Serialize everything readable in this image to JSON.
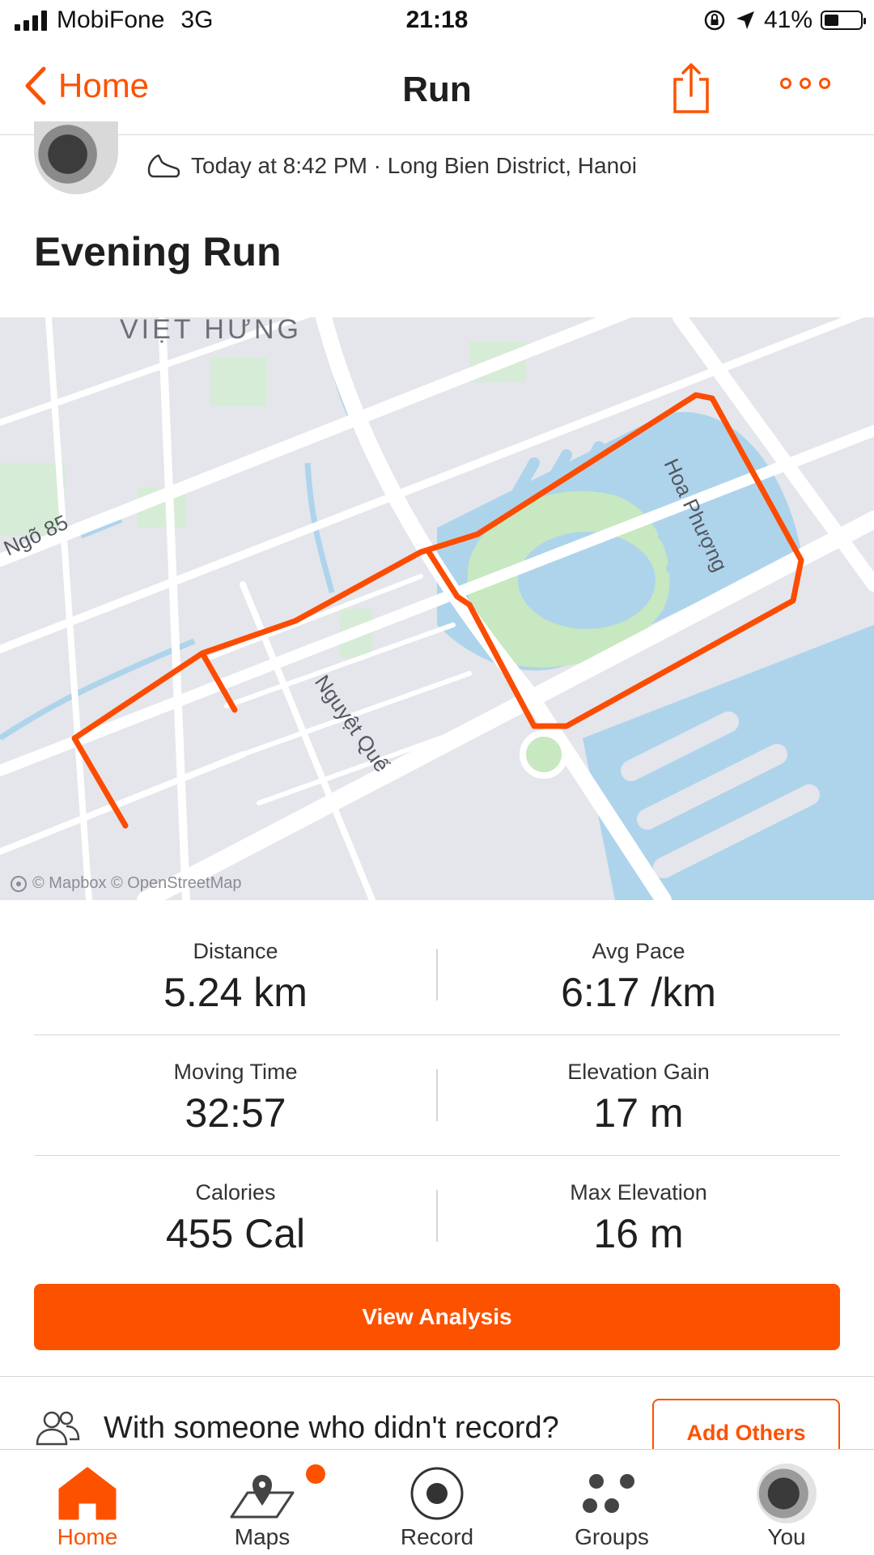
{
  "status_bar": {
    "carrier": "MobiFone",
    "network": "3G",
    "time": "21:18",
    "battery": "41%",
    "battery_level": 0.41
  },
  "nav": {
    "back_label": "Home",
    "title": "Run"
  },
  "activity": {
    "meta": "Today at 8:42 PM · Long Bien District, Hanoi",
    "title": "Evening Run"
  },
  "map": {
    "labels": {
      "district": "VIỆT HƯNG",
      "street_1": "Ngõ 85",
      "street_2": "Hoa Phượng",
      "street_3": "Nguyệt Quế"
    },
    "credit": "© Mapbox © OpenStreetMap",
    "route_color": "#fc4c02"
  },
  "stats": [
    {
      "label": "Distance",
      "value": "5.24 km"
    },
    {
      "label": "Avg Pace",
      "value": "6:17 /km"
    },
    {
      "label": "Moving Time",
      "value": "32:57"
    },
    {
      "label": "Elevation Gain",
      "value": "17 m"
    },
    {
      "label": "Calories",
      "value": "455 Cal"
    },
    {
      "label": "Max Elevation",
      "value": "16 m"
    }
  ],
  "actions": {
    "view_analysis": "View Analysis",
    "others_prompt": "With someone who didn't record?",
    "add_others": "Add Others"
  },
  "tabs": [
    {
      "label": "Home",
      "icon": "home-icon",
      "active": true
    },
    {
      "label": "Maps",
      "icon": "maps-icon",
      "active": false
    },
    {
      "label": "Record",
      "icon": "record-icon",
      "active": false
    },
    {
      "label": "Groups",
      "icon": "groups-icon",
      "active": false
    },
    {
      "label": "You",
      "icon": "avatar",
      "active": false
    }
  ],
  "colors": {
    "brand": "#fc5200",
    "text": "#1f1f1f",
    "water": "#aed4ec",
    "park": "#c7e8c0"
  }
}
